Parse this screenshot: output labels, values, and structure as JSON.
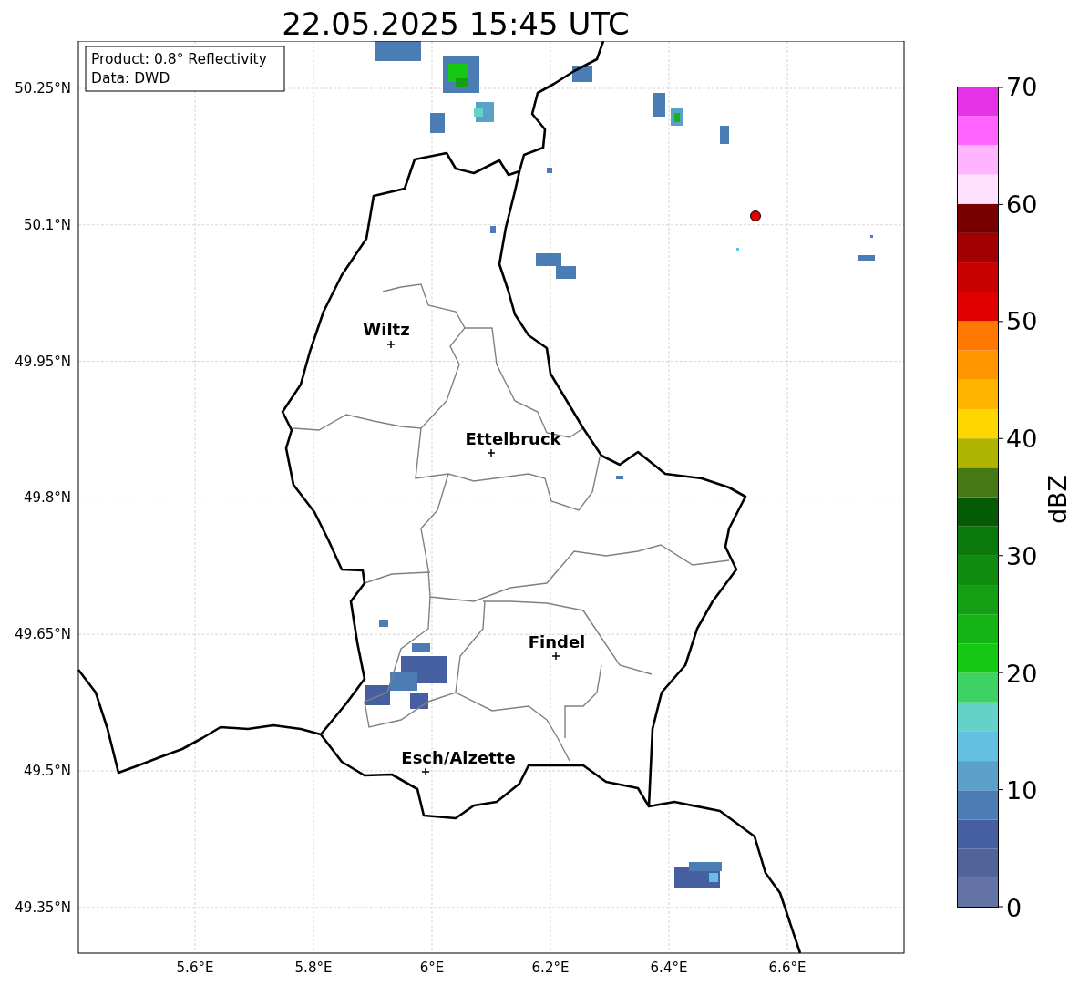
{
  "title": "22.05.2025 15:45 UTC",
  "info_box": {
    "lines": [
      "Product: 0.8° Reflectivity",
      "Data: DWD"
    ]
  },
  "map": {
    "lat_ticks": [
      "50.25°N",
      "50.1°N",
      "49.95°N",
      "49.8°N",
      "49.65°N",
      "49.5°N",
      "49.35°N"
    ],
    "lon_ticks": [
      "5.6°E",
      "5.8°E",
      "6°E",
      "6.2°E",
      "6.4°E",
      "6.6°E"
    ],
    "cities": [
      {
        "name": "Wiltz"
      },
      {
        "name": "Ettelbruck"
      },
      {
        "name": "Findel"
      },
      {
        "name": "Esch/Alzette"
      }
    ]
  },
  "colorbar": {
    "label": "dBZ",
    "ticks": [
      "70",
      "60",
      "50",
      "40",
      "30",
      "20",
      "10",
      "0"
    ]
  }
}
